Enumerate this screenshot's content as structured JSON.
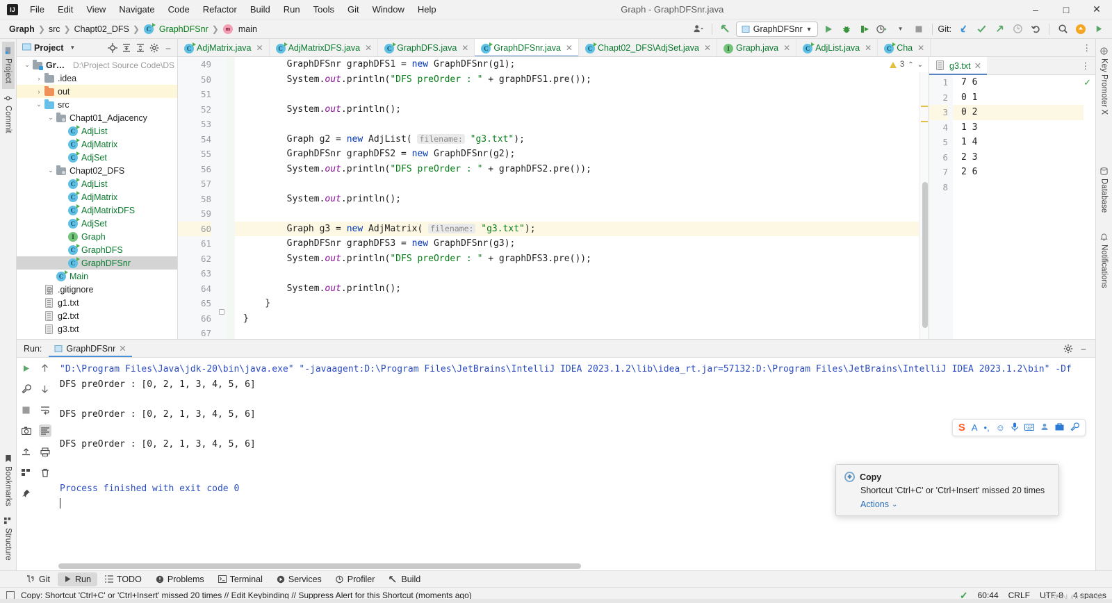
{
  "window": {
    "title": "Graph - GraphDFSnr.java",
    "logo": "IJ",
    "minimize": "–",
    "maximize": "□",
    "close": "✕"
  },
  "menu": [
    "File",
    "Edit",
    "View",
    "Navigate",
    "Code",
    "Refactor",
    "Build",
    "Run",
    "Tools",
    "Git",
    "Window",
    "Help"
  ],
  "breadcrumbs": [
    {
      "label": "Graph",
      "icon": ""
    },
    {
      "label": "src",
      "icon": ""
    },
    {
      "label": "Chapt02_DFS",
      "icon": ""
    },
    {
      "label": "GraphDFSnr",
      "icon": "class-icon"
    },
    {
      "label": "main",
      "icon": "method-icon"
    }
  ],
  "toolbar": {
    "run_config": "GraphDFSnr",
    "git_label": "Git:",
    "icons": [
      "user-icon",
      "back-arrow-icon",
      "run-icon",
      "debug-icon",
      "run-coverage-icon",
      "profiler-icon",
      "stop-icon",
      "git-update-icon",
      "git-commit-icon",
      "git-push-icon",
      "git-history-icon",
      "git-rollback-icon",
      "search-icon",
      "updates-icon"
    ]
  },
  "left_rail": {
    "top": [
      {
        "label": "Project",
        "icon": "project-icon",
        "active": true
      },
      {
        "label": "Commit",
        "icon": "commit-icon",
        "active": false
      }
    ],
    "bottom": [
      {
        "label": "Bookmarks",
        "icon": "bookmark-icon"
      },
      {
        "label": "Structure",
        "icon": "structure-icon"
      }
    ]
  },
  "right_rail": [
    {
      "label": "Key Promoter X",
      "icon": "key-promoter-icon"
    },
    {
      "label": "Database",
      "icon": "database-icon"
    },
    {
      "label": "Notifications",
      "icon": "notifications-icon"
    }
  ],
  "project": {
    "title": "Project",
    "header_icons": [
      "chevron-down-icon",
      "locate-icon",
      "expand-all-icon",
      "collapse-all-icon",
      "settings-icon",
      "hide-icon"
    ],
    "tree": [
      {
        "indent": 0,
        "arrow": "⌄",
        "icon": "module-folder",
        "label": "Graph",
        "bold": true,
        "path": "D:\\Project Source Code\\DS",
        "state": "normal"
      },
      {
        "indent": 1,
        "arrow": "›",
        "icon": "folder-gray",
        "label": ".idea",
        "bold": false,
        "path": "",
        "state": "normal"
      },
      {
        "indent": 1,
        "arrow": "›",
        "icon": "folder-orange",
        "label": "out",
        "bold": false,
        "path": "",
        "state": "highlight"
      },
      {
        "indent": 1,
        "arrow": "⌄",
        "icon": "folder-blue",
        "label": "src",
        "bold": false,
        "path": "",
        "state": "normal"
      },
      {
        "indent": 2,
        "arrow": "⌄",
        "icon": "folder-package",
        "label": "Chapt01_Adjacency",
        "bold": false,
        "path": "",
        "state": "normal"
      },
      {
        "indent": 3,
        "arrow": "",
        "icon": "class-icon",
        "label": "AdjList",
        "bold": false,
        "path": "",
        "state": "normal"
      },
      {
        "indent": 3,
        "arrow": "",
        "icon": "class-icon",
        "label": "AdjMatrix",
        "bold": false,
        "path": "",
        "state": "normal"
      },
      {
        "indent": 3,
        "arrow": "",
        "icon": "class-icon",
        "label": "AdjSet",
        "bold": false,
        "path": "",
        "state": "normal"
      },
      {
        "indent": 2,
        "arrow": "⌄",
        "icon": "folder-package",
        "label": "Chapt02_DFS",
        "bold": false,
        "path": "",
        "state": "normal"
      },
      {
        "indent": 3,
        "arrow": "",
        "icon": "class-icon",
        "label": "AdjList",
        "bold": false,
        "path": "",
        "state": "normal"
      },
      {
        "indent": 3,
        "arrow": "",
        "icon": "class-icon",
        "label": "AdjMatrix",
        "bold": false,
        "path": "",
        "state": "normal"
      },
      {
        "indent": 3,
        "arrow": "",
        "icon": "class-icon",
        "label": "AdjMatrixDFS",
        "bold": false,
        "path": "",
        "state": "normal"
      },
      {
        "indent": 3,
        "arrow": "",
        "icon": "class-icon",
        "label": "AdjSet",
        "bold": false,
        "path": "",
        "state": "normal"
      },
      {
        "indent": 3,
        "arrow": "",
        "icon": "interface-icon",
        "label": "Graph",
        "bold": false,
        "path": "",
        "state": "normal"
      },
      {
        "indent": 3,
        "arrow": "",
        "icon": "class-icon",
        "label": "GraphDFS",
        "bold": false,
        "path": "",
        "state": "normal"
      },
      {
        "indent": 3,
        "arrow": "",
        "icon": "class-icon",
        "label": "GraphDFSnr",
        "bold": false,
        "path": "",
        "state": "selected"
      },
      {
        "indent": 2,
        "arrow": "",
        "icon": "class-icon",
        "label": "Main",
        "bold": false,
        "path": "",
        "state": "normal"
      },
      {
        "indent": 1,
        "arrow": "",
        "icon": "gitignore-icon",
        "label": ".gitignore",
        "bold": false,
        "path": "",
        "state": "normal"
      },
      {
        "indent": 1,
        "arrow": "",
        "icon": "file-icon",
        "label": "g1.txt",
        "bold": false,
        "path": "",
        "state": "normal"
      },
      {
        "indent": 1,
        "arrow": "",
        "icon": "file-icon",
        "label": "g2.txt",
        "bold": false,
        "path": "",
        "state": "normal"
      },
      {
        "indent": 1,
        "arrow": "",
        "icon": "file-icon",
        "label": "g3.txt",
        "bold": false,
        "path": "",
        "state": "normal"
      }
    ]
  },
  "editor_tabs": [
    {
      "label": "AdjMatrix.java",
      "icon": "class-icon",
      "active": false
    },
    {
      "label": "AdjMatrixDFS.java",
      "icon": "class-icon",
      "active": false
    },
    {
      "label": "GraphDFS.java",
      "icon": "class-icon",
      "active": false
    },
    {
      "label": "GraphDFSnr.java",
      "icon": "class-icon",
      "active": true
    },
    {
      "label": "Chapt02_DFS\\AdjSet.java",
      "icon": "class-icon",
      "active": false
    },
    {
      "label": "Graph.java",
      "icon": "interface-icon",
      "active": false
    },
    {
      "label": "AdjList.java",
      "icon": "class-icon",
      "active": false
    },
    {
      "label": "Cha",
      "icon": "class-icon",
      "active": false
    }
  ],
  "inspection": {
    "warnings": "3",
    "warn_icon": "warning-icon"
  },
  "code": {
    "first_line": 49,
    "lines": [
      {
        "n": 49,
        "hl": false,
        "tokens": [
          {
            "t": "        GraphDFSnr graphDFS1 = ",
            "c": ""
          },
          {
            "t": "new",
            "c": "kw"
          },
          {
            "t": " GraphDFSnr(g1);",
            "c": ""
          }
        ]
      },
      {
        "n": 50,
        "hl": false,
        "tokens": [
          {
            "t": "        System.",
            "c": ""
          },
          {
            "t": "out",
            "c": "fld"
          },
          {
            "t": ".println(",
            "c": ""
          },
          {
            "t": "\"DFS preOrder : \"",
            "c": "str"
          },
          {
            "t": " + graphDFS1.pre());",
            "c": ""
          }
        ]
      },
      {
        "n": 51,
        "hl": false,
        "tokens": [
          {
            "t": "",
            "c": ""
          }
        ]
      },
      {
        "n": 52,
        "hl": false,
        "tokens": [
          {
            "t": "        System.",
            "c": ""
          },
          {
            "t": "out",
            "c": "fld"
          },
          {
            "t": ".println();",
            "c": ""
          }
        ]
      },
      {
        "n": 53,
        "hl": false,
        "tokens": [
          {
            "t": "",
            "c": ""
          }
        ]
      },
      {
        "n": 54,
        "hl": false,
        "tokens": [
          {
            "t": "        Graph g2 = ",
            "c": ""
          },
          {
            "t": "new",
            "c": "kw"
          },
          {
            "t": " AdjList( ",
            "c": ""
          },
          {
            "t": "filename:",
            "c": "hint"
          },
          {
            "t": " ",
            "c": ""
          },
          {
            "t": "\"g3.txt\"",
            "c": "str"
          },
          {
            "t": ");",
            "c": ""
          }
        ]
      },
      {
        "n": 55,
        "hl": false,
        "tokens": [
          {
            "t": "        GraphDFSnr graphDFS2 = ",
            "c": ""
          },
          {
            "t": "new",
            "c": "kw"
          },
          {
            "t": " GraphDFSnr(g2);",
            "c": ""
          }
        ]
      },
      {
        "n": 56,
        "hl": false,
        "tokens": [
          {
            "t": "        System.",
            "c": ""
          },
          {
            "t": "out",
            "c": "fld"
          },
          {
            "t": ".println(",
            "c": ""
          },
          {
            "t": "\"DFS preOrder : \"",
            "c": "str"
          },
          {
            "t": " + graphDFS2.pre());",
            "c": ""
          }
        ]
      },
      {
        "n": 57,
        "hl": false,
        "tokens": [
          {
            "t": "",
            "c": ""
          }
        ]
      },
      {
        "n": 58,
        "hl": false,
        "tokens": [
          {
            "t": "        System.",
            "c": ""
          },
          {
            "t": "out",
            "c": "fld"
          },
          {
            "t": ".println();",
            "c": ""
          }
        ]
      },
      {
        "n": 59,
        "hl": false,
        "tokens": [
          {
            "t": "",
            "c": ""
          }
        ]
      },
      {
        "n": 60,
        "hl": true,
        "tokens": [
          {
            "t": "        Graph g3 = ",
            "c": ""
          },
          {
            "t": "new",
            "c": "kw"
          },
          {
            "t": " AdjMatrix( ",
            "c": ""
          },
          {
            "t": "filename:",
            "c": "hint"
          },
          {
            "t": " ",
            "c": ""
          },
          {
            "t": "\"g3.txt\"",
            "c": "str"
          },
          {
            "t": ");",
            "c": ""
          }
        ]
      },
      {
        "n": 61,
        "hl": false,
        "tokens": [
          {
            "t": "        GraphDFSnr graphDFS3 = ",
            "c": ""
          },
          {
            "t": "new",
            "c": "kw"
          },
          {
            "t": " GraphDFSnr(g3);",
            "c": ""
          }
        ]
      },
      {
        "n": 62,
        "hl": false,
        "tokens": [
          {
            "t": "        System.",
            "c": ""
          },
          {
            "t": "out",
            "c": "fld"
          },
          {
            "t": ".println(",
            "c": ""
          },
          {
            "t": "\"DFS preOrder : \"",
            "c": "str"
          },
          {
            "t": " + graphDFS3.pre());",
            "c": ""
          }
        ]
      },
      {
        "n": 63,
        "hl": false,
        "tokens": [
          {
            "t": "",
            "c": ""
          }
        ]
      },
      {
        "n": 64,
        "hl": false,
        "tokens": [
          {
            "t": "        System.",
            "c": ""
          },
          {
            "t": "out",
            "c": "fld"
          },
          {
            "t": ".println();",
            "c": ""
          }
        ]
      },
      {
        "n": 65,
        "hl": false,
        "tokens": [
          {
            "t": "    }",
            "c": ""
          }
        ]
      },
      {
        "n": 66,
        "hl": false,
        "tokens": [
          {
            "t": "}",
            "c": ""
          }
        ]
      },
      {
        "n": 67,
        "hl": false,
        "tokens": [
          {
            "t": "",
            "c": ""
          }
        ]
      }
    ]
  },
  "right_editor": {
    "tab_label": "g3.txt",
    "tab_icon": "file-icon",
    "close_icon": "✕",
    "check_icon": "✓",
    "lines": [
      {
        "n": 1,
        "text": "7 6",
        "hl": false
      },
      {
        "n": 2,
        "text": "0 1",
        "hl": false
      },
      {
        "n": 3,
        "text": "0 2",
        "hl": true
      },
      {
        "n": 4,
        "text": "1 3",
        "hl": false
      },
      {
        "n": 5,
        "text": "1 4",
        "hl": false
      },
      {
        "n": 6,
        "text": "2 3",
        "hl": false
      },
      {
        "n": 7,
        "text": "2 6",
        "hl": false
      },
      {
        "n": 8,
        "text": "",
        "hl": false
      }
    ]
  },
  "run": {
    "label": "Run:",
    "tab": "GraphDFSnr",
    "tab_icon": "run-config-icon",
    "close_icon": "✕",
    "header_icons": [
      "settings-icon",
      "hide-icon"
    ],
    "side_icons": [
      "rerun-icon",
      "up-arrow-icon",
      "wrench-icon",
      "down-arrow-icon",
      "stop-icon",
      "soft-wrap-icon",
      "scroll-end-icon",
      "print-icon",
      "camera-icon",
      "export-icon",
      "trash-icon"
    ],
    "console": [
      {
        "text": "\"D:\\Program Files\\Java\\jdk-20\\bin\\java.exe\" \"-javaagent:D:\\Program Files\\JetBrains\\IntelliJ IDEA 2023.1.2\\lib\\idea_rt.jar=57132:D:\\Program Files\\JetBrains\\IntelliJ IDEA 2023.1.2\\bin\" -Df",
        "style": "cmd"
      },
      {
        "text": "DFS preOrder : [0, 2, 1, 3, 4, 5, 6]",
        "style": "normal"
      },
      {
        "text": "",
        "style": "normal"
      },
      {
        "text": "DFS preOrder : [0, 2, 1, 3, 4, 5, 6]",
        "style": "normal"
      },
      {
        "text": "",
        "style": "normal"
      },
      {
        "text": "DFS preOrder : [0, 2, 1, 3, 4, 5, 6]",
        "style": "normal"
      },
      {
        "text": "",
        "style": "normal"
      },
      {
        "text": "",
        "style": "normal"
      },
      {
        "text": "Process finished with exit code 0",
        "style": "fin"
      }
    ]
  },
  "ime": {
    "logo": "S",
    "icons": [
      "A",
      "voice-punct-icon",
      "emoji-icon",
      "mic-icon",
      "keyboard-icon",
      "user-icon",
      "toolbox-icon",
      "wrench-icon"
    ]
  },
  "notification": {
    "icon": "key-promoter-icon",
    "title": "Copy",
    "body": "Shortcut 'Ctrl+C' or 'Ctrl+Insert' missed 20 times",
    "actions": "Actions",
    "chevron": "⌄"
  },
  "toolwindows": [
    {
      "label": "Git",
      "icon": "git-icon",
      "active": false
    },
    {
      "label": "Run",
      "icon": "run-icon",
      "active": true
    },
    {
      "label": "TODO",
      "icon": "todo-icon",
      "active": false
    },
    {
      "label": "Problems",
      "icon": "problems-icon",
      "active": false
    },
    {
      "label": "Terminal",
      "icon": "terminal-icon",
      "active": false
    },
    {
      "label": "Services",
      "icon": "services-icon",
      "active": false
    },
    {
      "label": "Profiler",
      "icon": "profiler-icon",
      "active": false
    },
    {
      "label": "Build",
      "icon": "build-icon",
      "active": false
    }
  ],
  "statusbar": {
    "message_icon": "event-log-icon",
    "message": "Copy: Shortcut 'Ctrl+C' or 'Ctrl+Insert' missed 20 times // Edit Keybinding // Suppress Alert for this Shortcut (moments ago)",
    "check_icon": "✓",
    "position": "60:44",
    "line_sep": "CRLF",
    "encoding": "UTF-8",
    "indent": "4 spaces",
    "watermark": "CSDN @大大柳"
  },
  "colors": {
    "accent": "#4a90d9",
    "keyword": "#0033b3",
    "string": "#067d17",
    "field": "#871094",
    "selection": "#d4d4d4",
    "highlight_line": "#fdf8e3"
  }
}
